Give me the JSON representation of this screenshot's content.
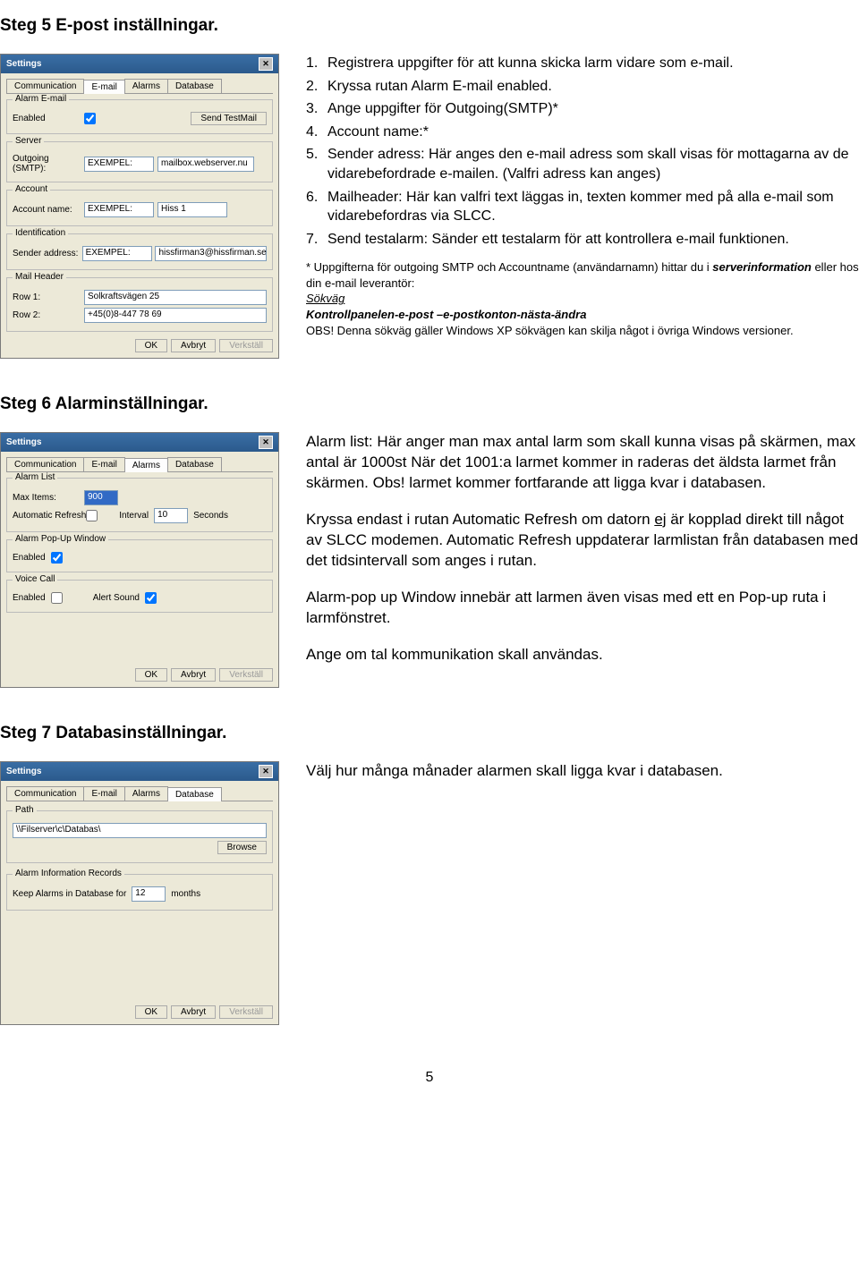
{
  "step5": {
    "heading": "Steg 5 E-post inställningar.",
    "dialog": {
      "title": "Settings",
      "tabs": [
        "Communication",
        "E-mail",
        "Alarms",
        "Database"
      ],
      "active_tab": 1,
      "alarm_email_title": "Alarm E-mail",
      "enabled_label": "Enabled",
      "send_test_btn": "Send TestMail",
      "server_title": "Server",
      "outgoing_label": "Outgoing (SMTP):",
      "outgoing_val": "EXEMPEL:",
      "outgoing_val2": "mailbox.webserver.nu",
      "account_title": "Account",
      "account_label": "Account name:",
      "account_val": "EXEMPEL:",
      "account_val2": "Hiss 1",
      "id_title": "Identification",
      "sender_label": "Sender address:",
      "sender_val": "EXEMPEL:",
      "sender_val2": "hissfirman3@hissfirman.se",
      "mail_header_title": "Mail Header",
      "row1_label": "Row 1:",
      "row1_val": "Solkraftsvägen 25",
      "row2_label": "Row 2:",
      "row2_val": "+45(0)8-447 78 69",
      "ok": "OK",
      "cancel": "Avbryt",
      "apply": "Verkställ"
    },
    "instructions": [
      {
        "n": "1.",
        "t": "Registrera uppgifter för att kunna skicka larm vidare som e-mail."
      },
      {
        "n": "2.",
        "t": "Kryssa rutan Alarm E-mail enabled."
      },
      {
        "n": "3.",
        "t": "Ange uppgifter för Outgoing(SMTP)*"
      },
      {
        "n": "4.",
        "t": "Account name:*"
      },
      {
        "n": "5.",
        "t": "Sender adress: Här anges den e-mail adress som skall visas för mottagarna av de vidarebefordrade e-mailen. (Valfri adress kan anges)"
      },
      {
        "n": "6.",
        "t": "Mailheader: Här kan valfri text läggas in, texten kommer med på alla e-mail som vidarebefordras via SLCC."
      },
      {
        "n": "7.",
        "t": "Send testalarm: Sänder ett testalarm  för att kontrollera e-mail funktionen."
      }
    ],
    "note_line1": "*  Uppgifterna för outgoing SMTP och Accountname (användarnamn) hittar du i ",
    "note_line1b": "serverinformation",
    "note_line1c": " eller hos din e-mail leverantör:",
    "note_sokvag": "Sökväg",
    "note_path": "Kontrollpanelen-e-post –e-postkonton-nästa-ändra",
    "note_obs": "OBS! Denna sökväg gäller Windows XP sökvägen kan skilja något i övriga Windows versioner."
  },
  "step6": {
    "heading": "Steg 6 Alarminställningar.",
    "dialog": {
      "title": "Settings",
      "tabs": [
        "Communication",
        "E-mail",
        "Alarms",
        "Database"
      ],
      "active_tab": 2,
      "alarm_list_title": "Alarm List",
      "max_items_label": "Max Items:",
      "max_items_val": "900",
      "auto_refresh_label": "Automatic Refresh",
      "interval_label": "Interval",
      "interval_val": "10",
      "seconds_label": "Seconds",
      "popup_title": "Alarm Pop-Up Window",
      "enabled_label": "Enabled",
      "voice_title": "Voice Call",
      "alert_sound_label": "Alert Sound",
      "ok": "OK",
      "cancel": "Avbryt",
      "apply": "Verkställ"
    },
    "paras": [
      "Alarm list: Här anger man max antal larm som\nskall kunna visas på skärmen, max antal är 1000st\nNär det 1001:a larmet kommer in raderas det äldsta larmet från skärmen. Obs! larmet kommer fortfarande att ligga kvar i databasen.",
      "Kryssa endast i rutan Automatic Refresh om datorn ej är kopplad direkt till något av SLCC modemen. Automatic Refresh uppdaterar larmlistan från databasen med det tidsintervall som anges i rutan.",
      "Alarm-pop up Window innebär att larmen även visas med ett en Pop-up ruta i larmfönstret.",
      "Ange om tal kommunikation skall användas."
    ]
  },
  "step7": {
    "heading": "Steg 7 Databasinställningar.",
    "dialog": {
      "title": "Settings",
      "tabs": [
        "Communication",
        "E-mail",
        "Alarms",
        "Database"
      ],
      "active_tab": 3,
      "path_title": "Path",
      "path_val": "\\\\Filserver\\c\\Databas\\",
      "browse_btn": "Browse",
      "records_title": "Alarm Information Records",
      "keep_label": "Keep Alarms in Database for",
      "keep_val": "12",
      "months_label": "months",
      "ok": "OK",
      "cancel": "Avbryt",
      "apply": "Verkställ"
    },
    "para": "Välj hur många månader alarmen skall ligga kvar i databasen."
  },
  "page_number": "5"
}
